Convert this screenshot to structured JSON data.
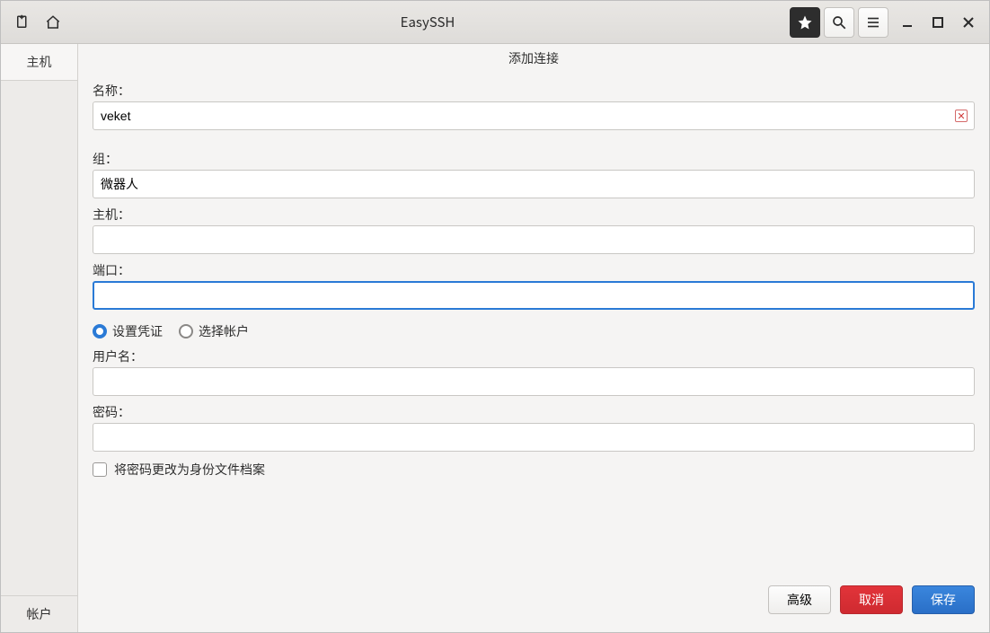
{
  "titlebar": {
    "title": "EasySSH"
  },
  "sidebar": {
    "top_tab": "主机",
    "bottom_tab": "帐户"
  },
  "pane": {
    "title": "添加连接",
    "name_label": "名称：",
    "name_value": "veket",
    "group_label": "组：",
    "group_value": "微器人",
    "host_label": "主机：",
    "host_value": "",
    "port_label": "端口：",
    "port_value": "",
    "radio_credentials": "设置凭证",
    "radio_account": "选择帐户",
    "username_label": "用户名：",
    "username_value": "",
    "password_label": "密码：",
    "password_value": "",
    "identity_check": "将密码更改为身份文件档案"
  },
  "buttons": {
    "advanced": "高级",
    "cancel": "取消",
    "save": "保存"
  }
}
